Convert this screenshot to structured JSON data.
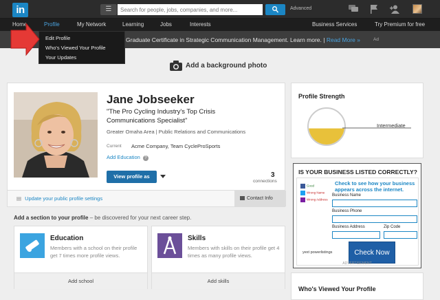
{
  "topbar": {
    "logo": "in",
    "search": {
      "placeholder": "Search for people, jobs, companies, and more..."
    },
    "advanced_label": "Advanced",
    "icons": [
      "menu-icon",
      "search-icon",
      "messages-icon",
      "flag-icon",
      "add-connection-icon",
      "profile-photo"
    ]
  },
  "nav": {
    "items": [
      "Home",
      "Profile",
      "My Network",
      "Learning",
      "Jobs",
      "Interests",
      "Business Services",
      "Try Premium for free"
    ],
    "active": "Profile"
  },
  "dropdown": {
    "items": [
      "Edit Profile",
      "Who's Viewed Your Profile",
      "Your Updates"
    ]
  },
  "promo": {
    "text": "Graduate Certificate in Strategic Communication Management. Learn more.",
    "link": "Read More »",
    "ad": "Ad"
  },
  "background": {
    "label": "Add a background photo"
  },
  "profile": {
    "name": "Jane Jobseeker",
    "headline": "\"The Pro Cycling Industry's Top Crisis Communications Specialist\"",
    "location": "Greater Omaha Area",
    "industry": "Public Relations and Communications",
    "location_sep": "|",
    "current_label": "Current",
    "current_value": "Acme Company, Team CycleProSports",
    "add_education": "Add Education",
    "view_button": "View profile as",
    "connections_count": "3",
    "connections_label": "connections"
  },
  "public_row": {
    "link": "Update your public profile settings",
    "contact": "Contact Info"
  },
  "add_section": {
    "title": "Add a section to your profile",
    "subtitle": "– be discovered for your next career step."
  },
  "sections": [
    {
      "title": "Education",
      "desc": "Members with a school on their profile get 7 times more profile views.",
      "button": "Add school",
      "color": "#3ba4e0"
    },
    {
      "title": "Skills",
      "desc": "Members with skills on their profile get 4 times as many profile views.",
      "button": "Add skills",
      "color": "#6b4f99"
    }
  ],
  "strength": {
    "title": "Profile Strength",
    "level": "Intermediate",
    "fill_fraction": 0.45
  },
  "ad_box": {
    "title": "IS YOUR BUSINESS LISTED CORRECTLY?",
    "headline": "Check to see how your business appears across the internet.",
    "labels": {
      "name": "Business Name",
      "phone": "Business Phone",
      "address": "Business Address",
      "zip": "Zip Code"
    },
    "social": [
      "Good",
      "Wrong Name",
      "Wrong Address"
    ],
    "brand": "yext powerlistings",
    "cta": "Check Now",
    "advertisement": "ADVERTISEMENT"
  },
  "who_viewed": {
    "title": "Who's Viewed Your Profile"
  }
}
